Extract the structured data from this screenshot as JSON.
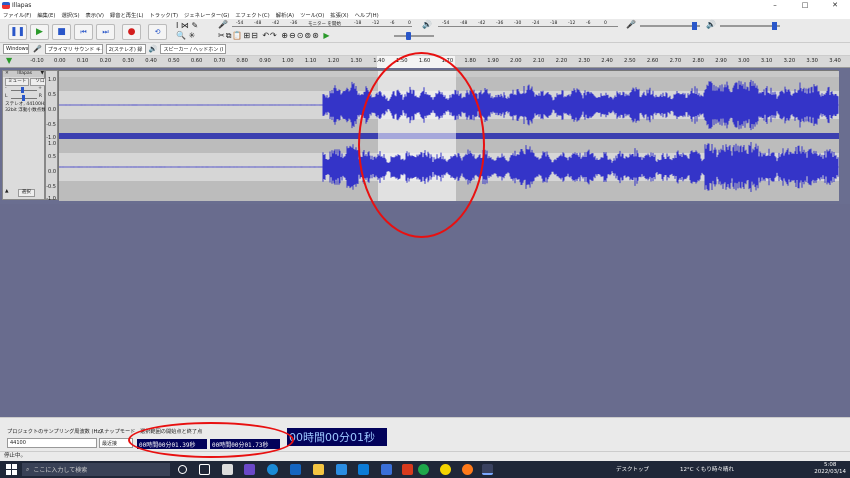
{
  "window": {
    "title": "Illapas",
    "controls": [
      "–",
      "□",
      "✕"
    ]
  },
  "menu": [
    "ファイル(F)",
    "編集(E)",
    "選択(S)",
    "表示(V)",
    "録音と再生(L)",
    "トラック(T)",
    "ジェネレーター(G)",
    "エフェクト(C)",
    "解析(A)",
    "ツール(O)",
    "拡張(X)",
    "ヘルプ(H)"
  ],
  "meters": {
    "record_ticks": [
      "-54",
      "-48",
      "-42",
      "-36",
      "-30",
      "-24",
      "-18",
      "-12",
      "-6",
      "0"
    ],
    "record_hint": "モニター を開始",
    "play_ticks": [
      "-54",
      "-48",
      "-42",
      "-36",
      "-30",
      "-24",
      "-18",
      "-12",
      "-6",
      "0"
    ]
  },
  "device_bar": {
    "host": "Windows",
    "input": "プライマリ サウンド キャプ",
    "channels": "2(ステレオ) 録",
    "output": "スピーカー / ヘッドホン (I"
  },
  "ruler": {
    "ticks": [
      "-0.10",
      "0.00",
      "0.10",
      "0.20",
      "0.30",
      "0.40",
      "0.50",
      "0.60",
      "0.70",
      "0.80",
      "0.90",
      "1.00",
      "1.10",
      "1.20",
      "1.30",
      "1.40",
      "1.50",
      "1.60",
      "1.70",
      "1.80",
      "1.90",
      "2.00",
      "2.10",
      "2.20",
      "2.30",
      "2.40",
      "2.50",
      "2.60",
      "2.70",
      "2.80",
      "2.90",
      "3.00",
      "3.10",
      "3.20",
      "3.30",
      "3.40"
    ]
  },
  "track": {
    "name": "Illapas",
    "mute": "ミュート",
    "solo": "ソロ",
    "gain_l": "L",
    "gain_r": "R",
    "info1": "ステレオ, 44100Hz",
    "info2": "32bit 浮動小数点数",
    "select": "選択",
    "scale": [
      "1.0",
      "0.5",
      "0.0",
      "-0.5",
      "-1.0",
      "1.0",
      "0.5",
      "0.0",
      "-0.5",
      "-1.0"
    ]
  },
  "selection_bar": {
    "rate_label": "プロジェクトのサンプリング周波数 (Hz)",
    "rate_value": "44100",
    "snap_label": "スナップモード",
    "snap_value": "最近接",
    "range_label": "選択範囲の開始点と終了点",
    "start": "00時間00分01.39秒",
    "end": "00時間00分01.73秒",
    "position": "00時間00分01秒"
  },
  "status": "停止中。",
  "taskbar": {
    "search_placeholder": "ここに入力して検索",
    "desktop": "デスクトップ",
    "weather": "12°C くもり時々晴れ",
    "time": "5:08",
    "date": "2022/03/14"
  }
}
